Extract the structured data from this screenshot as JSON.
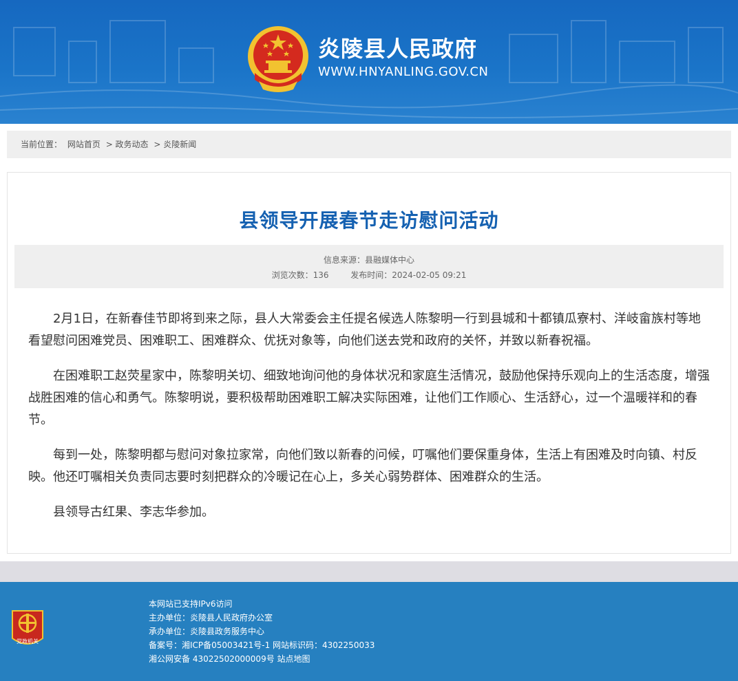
{
  "header": {
    "site_title": "炎陵县人民政府",
    "site_url": "WWW.HNYANLING.GOV.CN",
    "emblem_icon": "national-emblem-icon"
  },
  "breadcrumb": {
    "label": "当前位置：",
    "items": [
      "网站首页",
      "> 政务动态",
      "> 炎陵新闻"
    ]
  },
  "article": {
    "title": "县领导开展春节走访慰问活动",
    "meta": {
      "source": "信息来源：县融媒体中心",
      "views": "浏览次数：136",
      "published": "发布时间：2024-02-05 09:21"
    },
    "paragraphs": [
      "2月1日，在新春佳节即将到来之际，县人大常委会主任提名候选人陈黎明一行到县城和十都镇瓜寮村、洋岐畲族村等地看望慰问困难党员、困难职工、困难群众、优抚对象等，向他们送去党和政府的关怀，并致以新春祝福。",
      "在困难职工赵荧星家中，陈黎明关切、细致地询问他的身体状况和家庭生活情况，鼓励他保持乐观向上的生活态度，增强战胜困难的信心和勇气。陈黎明说，要积极帮助困难职工解决实际困难，让他们工作顺心、生活舒心，过一个温暖祥和的春节。",
      "每到一处，陈黎明都与慰问对象拉家常，向他们致以新春的问候，叮嘱他们要保重身体，生活上有困难及时向镇、村反映。他还叮嘱相关负责同志要时刻把群众的冷暖记在心上，多关心弱势群体、困难群众的生活。",
      "县领导古红果、李志华参加。"
    ]
  },
  "footer": {
    "badge_text": "党政机关",
    "lines": [
      "本网站已支持IPv6访问",
      "主办单位：炎陵县人民政府办公室",
      "承办单位：炎陵县政务服务中心",
      "备案号：湘ICP备05003421号-1 网站标识码：4302250033",
      "湘公网安备 43022502000009号 站点地图"
    ]
  },
  "colors": {
    "header_blue": "#1668c0",
    "title_blue": "#1561b1",
    "footer_blue": "#2680c0",
    "emblem_red": "#d42a1e",
    "emblem_gold": "#f2c230"
  }
}
